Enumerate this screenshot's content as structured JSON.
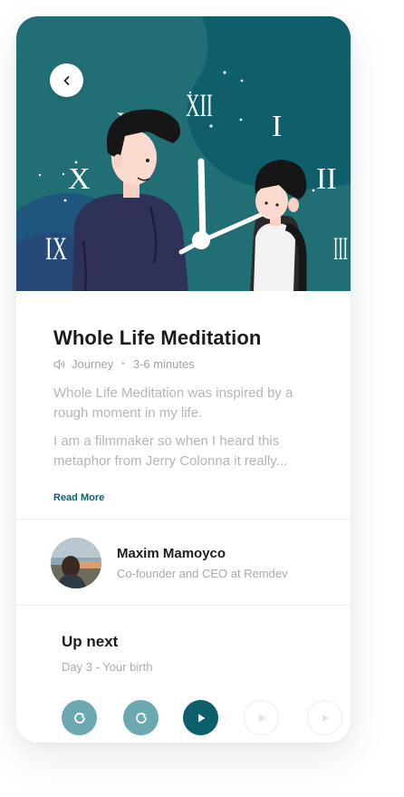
{
  "track": {
    "title": "Whole Life Meditation",
    "category": "Journey",
    "duration": "3-6 minutes",
    "description": [
      "Whole Life Meditation was inspired by a rough moment in my life.",
      "I am a filmmaker so when I heard this metaphor from Jerry Colonna it really..."
    ],
    "read_more_label": "Read More"
  },
  "author": {
    "name": "Maxim Mamoyco",
    "role": "Co-founder and CEO at Remdev"
  },
  "up_next": {
    "title": "Up next",
    "subtitle": "Day 3 -  Your birth"
  },
  "hero": {
    "clock_numerals": [
      "XII",
      "I",
      "II",
      "III",
      "IX",
      "X",
      "XI"
    ]
  },
  "controls": [
    {
      "icon": "replay-icon",
      "state": "enabled"
    },
    {
      "icon": "replay-icon",
      "state": "enabled"
    },
    {
      "icon": "play-icon",
      "state": "active"
    },
    {
      "icon": "play-icon",
      "state": "disabled"
    },
    {
      "icon": "play-icon",
      "state": "disabled"
    }
  ],
  "colors": {
    "accent": "#0d5f6c",
    "accent_light": "#6ca8b0",
    "hero_bg": "#1e6d73",
    "text_primary": "#1c1c1c",
    "text_secondary": "#a8a8a8"
  }
}
